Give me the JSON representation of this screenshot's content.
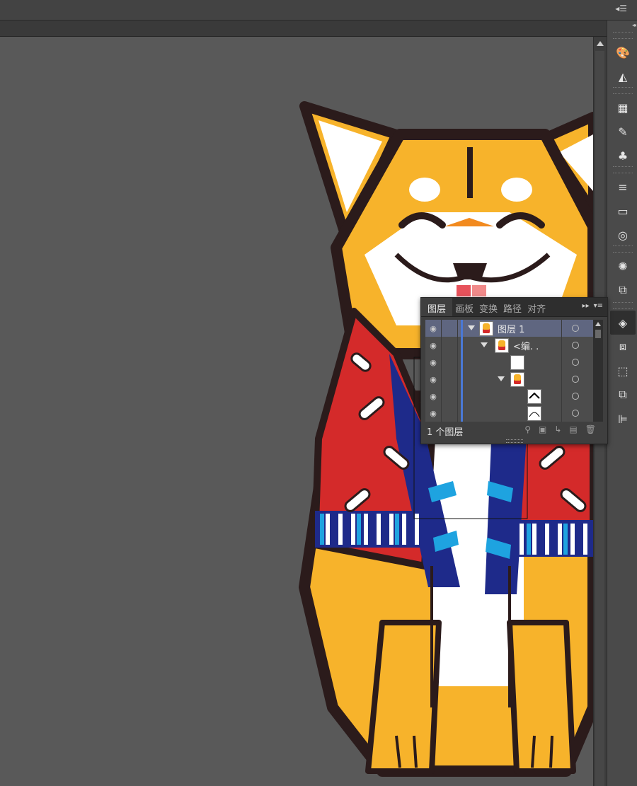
{
  "app": {
    "panel_menu_icon": "panel-menu-icon",
    "collapse_icon": "collapse-panels-icon"
  },
  "tools": [
    {
      "name": "color-palette-icon",
      "glyph": "🎨"
    },
    {
      "name": "color-guide-icon",
      "glyph": "◭"
    },
    {
      "name": "swatches-icon",
      "glyph": "▦"
    },
    {
      "name": "brushes-icon",
      "glyph": "✎"
    },
    {
      "name": "symbols-icon",
      "glyph": "♣"
    },
    {
      "name": "stroke-icon",
      "glyph": "≡"
    },
    {
      "name": "gradient-icon",
      "glyph": "▭"
    },
    {
      "name": "transparency-icon",
      "glyph": "◎"
    },
    {
      "name": "appearance-icon",
      "glyph": "✺"
    },
    {
      "name": "graphic-styles-icon",
      "glyph": "⧉"
    },
    {
      "name": "layers-icon",
      "glyph": "◈"
    },
    {
      "name": "artboards-icon",
      "glyph": "⧈"
    },
    {
      "name": "transform-icon",
      "glyph": "⬚"
    },
    {
      "name": "pathfinder-icon",
      "glyph": "⧉"
    },
    {
      "name": "align-icon",
      "glyph": "⊫"
    }
  ],
  "layers_panel": {
    "tabs": [
      "图层",
      "画板",
      "变换",
      "路径",
      "对齐"
    ],
    "active_tab": "图层",
    "rows": [
      {
        "label": "图层 1",
        "selected": true,
        "expanded": true,
        "thumb": "dog"
      },
      {
        "label": "<编. .",
        "selected": false,
        "expanded": true,
        "thumb": "dog"
      },
      {
        "label": "",
        "selected": false,
        "expanded": false,
        "thumb": "blank"
      },
      {
        "label": "",
        "selected": false,
        "expanded": true,
        "thumb": "dog"
      },
      {
        "label": "",
        "selected": false,
        "expanded": false,
        "thumb": "path-a"
      },
      {
        "label": "",
        "selected": false,
        "expanded": false,
        "thumb": "path-b"
      }
    ],
    "footer_count": "1 个图层"
  },
  "colors": {
    "canvas": "#595959",
    "fur": "#F7B32B",
    "outline": "#2B1B1B",
    "coat_red": "#D42A2A",
    "coat_blue": "#1E2A8A",
    "stripe_cyan": "#1EA3E0",
    "selection_blue": "#4A78D4"
  }
}
